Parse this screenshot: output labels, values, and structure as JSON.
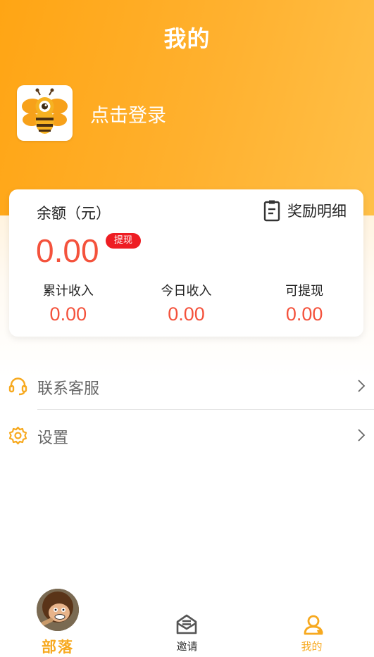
{
  "header": {
    "title": "我的"
  },
  "user": {
    "login_prompt": "点击登录"
  },
  "wallet": {
    "balance_label": "余额（元）",
    "balance": "0.00",
    "withdraw_badge": "提现",
    "reward_details_label": "奖励明细",
    "stats": [
      {
        "label": "累计收入",
        "value": "0.00"
      },
      {
        "label": "今日收入",
        "value": "0.00"
      },
      {
        "label": "可提现",
        "value": "0.00"
      }
    ]
  },
  "menu": [
    {
      "label": "联系客服",
      "icon": "headset-icon"
    },
    {
      "label": "设置",
      "icon": "gear-icon"
    }
  ],
  "tabbar": {
    "tabs": [
      {
        "label": "部落",
        "icon": "tribe-avatar"
      },
      {
        "label": "邀请",
        "icon": "invite-icon"
      },
      {
        "label": "我的",
        "icon": "profile-icon",
        "active": true
      }
    ]
  },
  "colors": {
    "accent": "#ffa514",
    "value_red": "#f4523c",
    "badge_red": "#ee1d23",
    "active_tab": "#f7a91f"
  }
}
